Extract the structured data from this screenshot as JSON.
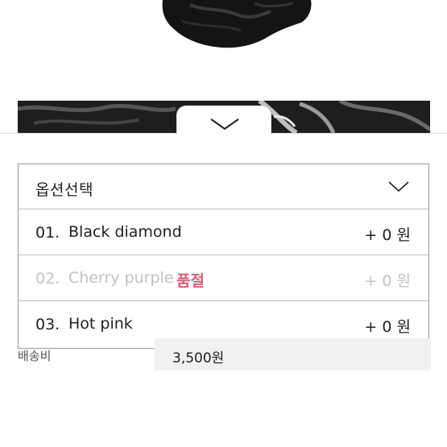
{
  "option_select": {
    "header_label": "옵션선택",
    "options": [
      {
        "number": "01.",
        "name": "Black diamond",
        "price": "+ 0 원",
        "sold_out": false,
        "badge": ""
      },
      {
        "number": "02.",
        "name": "Cherry purple",
        "price": "+ 0 원",
        "sold_out": true,
        "badge": "품절"
      },
      {
        "number": "03.",
        "name": "Hot pink",
        "price": "+ 0 원",
        "sold_out": false,
        "badge": ""
      }
    ]
  },
  "shipping": {
    "label": "배송비",
    "value": "3,500원"
  },
  "icons": {
    "collapse_handle": "chevron-down-icon",
    "header": "chevron-down-icon"
  },
  "colors": {
    "soldout_badge": "#d4607c",
    "disabled_text": "#c2c2c2",
    "text": "#222222"
  }
}
